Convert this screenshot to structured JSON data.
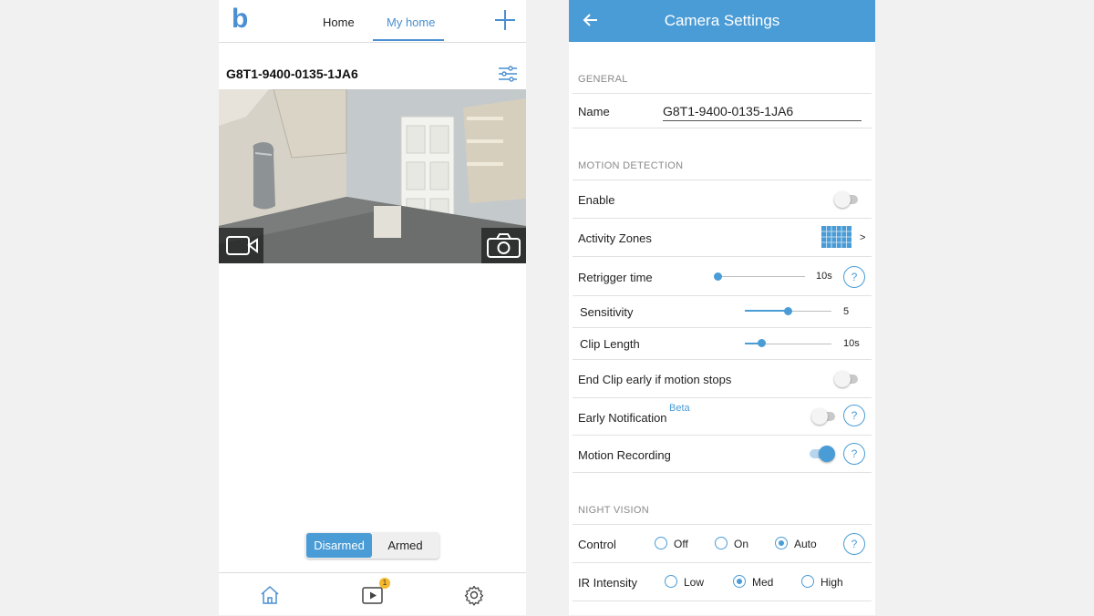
{
  "left": {
    "brand": "b",
    "tabs": [
      {
        "label": "Home"
      },
      {
        "label": "My home"
      }
    ],
    "active_tab": "My home",
    "camera_name": "G8T1-9400-0135-1JA6",
    "arm_toggle": {
      "disarmed": "Disarmed",
      "armed": "Armed",
      "selected": "Disarmed"
    },
    "nav": {
      "clips_badge": "1"
    }
  },
  "right": {
    "title": "Camera Settings",
    "general": {
      "section": "GENERAL",
      "name_label": "Name",
      "name_value": "G8T1-9400-0135-1JA6"
    },
    "motion": {
      "section": "MOTION DETECTION",
      "enable_label": "Enable",
      "enable_on": false,
      "zones_label": "Activity Zones",
      "zones_arrow": ">",
      "retrigger_label": "Retrigger time",
      "retrigger_value": "10s",
      "retrigger_fraction": 0.0,
      "sensitivity_label": "Sensitivity",
      "sensitivity_value": "5",
      "sensitivity_fraction": 0.5,
      "clip_label": "Clip Length",
      "clip_value": "10s",
      "clip_fraction": 0.2,
      "end_clip_label": "End Clip early if motion stops",
      "end_clip_on": false,
      "early_label": "Early Notification",
      "early_badge": "Beta",
      "early_on": false,
      "recording_label": "Motion Recording",
      "recording_on": true
    },
    "night": {
      "section": "NIGHT VISION",
      "control_label": "Control",
      "control_options": [
        "Off",
        "On",
        "Auto"
      ],
      "control_selected": "Auto",
      "ir_label": "IR Intensity",
      "ir_options": [
        "Low",
        "Med",
        "High"
      ],
      "ir_selected": "Med"
    }
  }
}
